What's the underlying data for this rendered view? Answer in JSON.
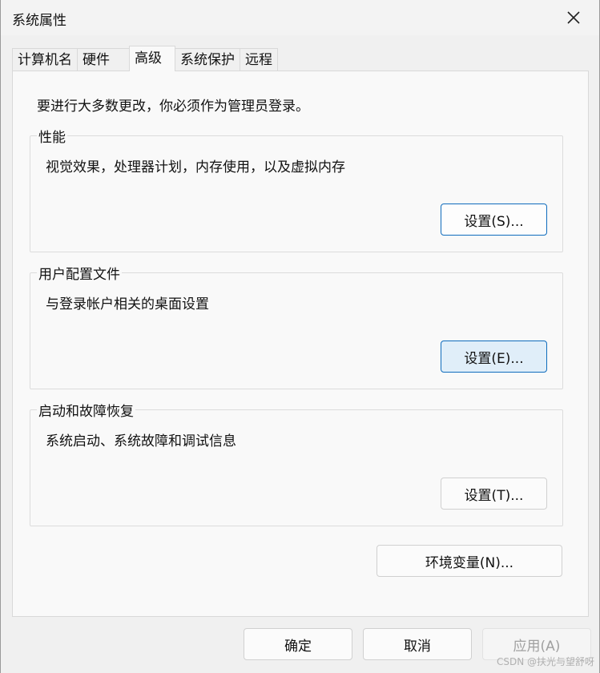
{
  "window": {
    "title": "系统属性",
    "close_icon": "close-icon"
  },
  "tabs": [
    {
      "label": "计算机名"
    },
    {
      "label": "硬件"
    },
    {
      "label": "高级",
      "active": true
    },
    {
      "label": "系统保护"
    },
    {
      "label": "远程"
    }
  ],
  "admin_note": "要进行大多数更改，你必须作为管理员登录。",
  "groups": [
    {
      "label": "性能",
      "desc": "视觉效果，处理器计划，内存使用，以及虚拟内存",
      "button": "设置(S)..."
    },
    {
      "label": "用户配置文件",
      "desc": "与登录帐户相关的桌面设置",
      "button": "设置(E)..."
    },
    {
      "label": "启动和故障恢复",
      "desc": "系统启动、系统故障和调试信息",
      "button": "设置(T)..."
    }
  ],
  "env_button": "环境变量(N)...",
  "footer": {
    "ok": "确定",
    "cancel": "取消",
    "apply": "应用(A)"
  },
  "watermark": "CSDN @扶光与望舒呀",
  "colors": {
    "accent": "#0f6cbd",
    "hover_bg": "#e0eef9"
  }
}
